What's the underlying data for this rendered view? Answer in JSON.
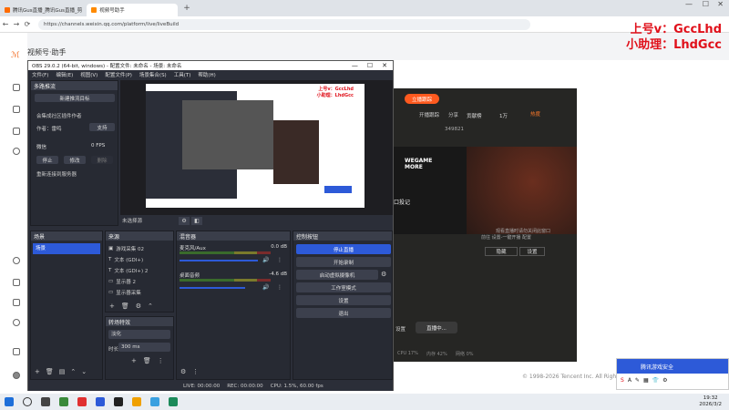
{
  "browser": {
    "tabs": [
      {
        "label": "腾讯Gus直播_腾讯Gus直播_剪"
      },
      {
        "label": "视频号助手"
      }
    ],
    "url": "https://channels.weixin.qq.com/platform/live/liveBuild"
  },
  "site": {
    "logo_text": "视频号·助手",
    "footer": "© 1998-2026 Tencent Inc. All Rights R"
  },
  "watermark": {
    "line1": "上号v：GccLhd",
    "line2": "小助理：LhdGcc"
  },
  "obs": {
    "title": "OBS 29.0.2 (64-bit, windows) - 配置文件: 未命名 - 场景: 未命名",
    "menu": [
      "文件(F)",
      "编辑(E)",
      "视图(V)",
      "配置文件(P)",
      "场景集合(S)",
      "工具(T)",
      "帮助(H)"
    ],
    "plugin": {
      "title": "多路推流",
      "manage": "新建推流目标",
      "desc": "会集成社区插件作者",
      "author": "作者：雷鸣",
      "support": "支持",
      "target": "微信",
      "fps": "0 FPS",
      "stop": "停止",
      "edit": "修改",
      "delete": "删除",
      "reconnect": "重新连接到服务器"
    },
    "scene_label": "未选择源",
    "docks": {
      "scenes": "场景",
      "sources": "来源",
      "mixer": "混音器",
      "controls": "控制按钮",
      "transitions": "转场特效"
    },
    "scene_item": "场景",
    "sources": [
      "游戏采集 02",
      "文本 (GDI+)",
      "文本 (GDI+) 2",
      "显示器 2",
      "显示器采集"
    ],
    "mixer": [
      {
        "name": "麦克风/Aux",
        "db": "0.0 dB"
      },
      {
        "name": "桌面音频",
        "db": "-4.6 dB"
      }
    ],
    "controls": [
      "停止直播",
      "开始录制",
      "启动虚拟摄像机",
      "工作室模式",
      "设置",
      "退出"
    ],
    "transition": {
      "type": "淡化",
      "duration_label": "时长",
      "duration": "300 ms"
    },
    "status": {
      "live": "LIVE: 00:00:00",
      "rec": "REC: 00:00:00",
      "cpu": "CPU: 1.5%, 60.00 fps"
    }
  },
  "tencent": {
    "start": "立播跟踪",
    "start_live": "开播跟踪",
    "share": "分享",
    "viewers": "349821",
    "tab_data": "贡献榜",
    "count": "1万",
    "hot": "热度",
    "game_brand": "WEGAME MORE",
    "game_label": "口投记",
    "hint1": "观看直播时请勿关闭此窗口",
    "hint2": "前往 设置-一键开播 配置",
    "btn_hide": "隐藏",
    "btn_settings": "设置",
    "live_btn": "直播中...",
    "settings_icon": "设置",
    "cpu": "CPU 17%",
    "mem": "内存 42%",
    "net": "网络 0%"
  },
  "taskbar": {
    "time": "19:32",
    "date": "2026/3/2"
  },
  "security_badge": {
    "title": "腾讯游戏安全"
  },
  "colors": {
    "accent": "#2d5ad8",
    "red": "#e0101a",
    "orange": "#ff5a1f"
  }
}
